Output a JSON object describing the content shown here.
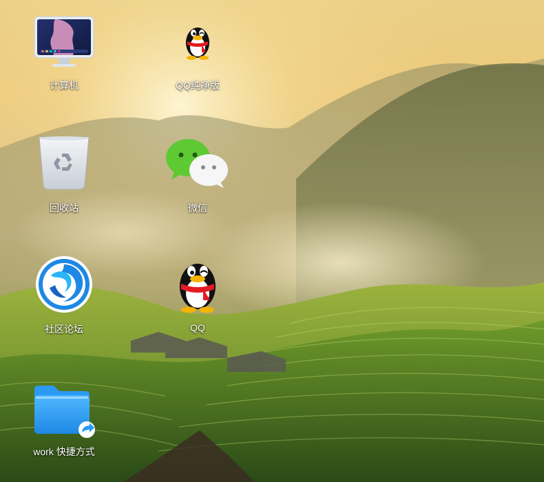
{
  "desktop": {
    "icons": [
      {
        "label": "计算机",
        "icon": "computer-icon"
      },
      {
        "label": "QQ纯净版",
        "icon": "qq-penguin-icon"
      },
      {
        "label": "回收站",
        "icon": "recycle-bin-icon"
      },
      {
        "label": "微信",
        "icon": "wechat-icon"
      },
      {
        "label": "社区论坛",
        "icon": "deepin-forum-icon"
      },
      {
        "label": "QQ",
        "icon": "qq-penguin-icon"
      },
      {
        "label": "work 快捷方式",
        "icon": "folder-shortcut-icon"
      }
    ]
  },
  "colors": {
    "qq_red": "#e31b23",
    "wechat_green": "#5fc934",
    "folder_blue": "#2b9af3",
    "deepin_blue": "#1e88e5"
  }
}
